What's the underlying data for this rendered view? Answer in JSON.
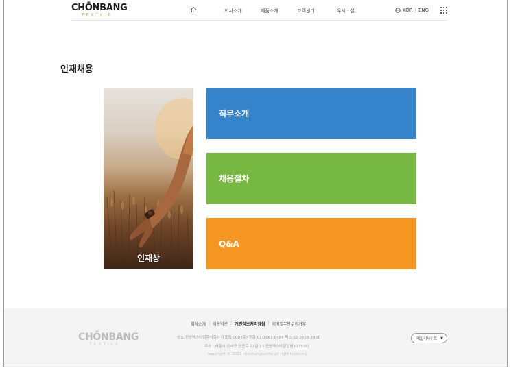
{
  "header": {
    "logo_main": "CHŌNBANG",
    "logo_sub": "TEXTILE",
    "nav": [
      {
        "label": "회사소개"
      },
      {
        "label": "제품소개"
      },
      {
        "label": "고객센터"
      },
      {
        "label": "우시 · 설"
      }
    ],
    "lang_kor": "KOR",
    "lang_sep": "|",
    "lang_eng": "ENG"
  },
  "page": {
    "title": "인재채용"
  },
  "hero": {
    "label": "인재상"
  },
  "menu": [
    {
      "label": "직무소개",
      "color": "#3583cb"
    },
    {
      "label": "채용절차",
      "color": "#77b843"
    },
    {
      "label": "Q&A",
      "color": "#f59522"
    }
  ],
  "footer": {
    "links": [
      {
        "label": "회사소개"
      },
      {
        "label": "이용약관"
      },
      {
        "label": "개인정보처리방침"
      },
      {
        "label": "이메일무단수집거부"
      }
    ],
    "logo_main": "CHŌNBANG",
    "logo_sub": "TEXTILE",
    "info_line1": "상호:전방텍스타일주식회사   대표자:000 (주)   전화:02-3663-8484   팩스:02-3663-8481",
    "info_line2": "주소 : 서울시 강서구 양천로 77길 13 전방텍스타일빌딩 (07538)",
    "info_line3": "copyright © 2023 chonbangtextile all right reserved.",
    "family_site": "패밀리사이트"
  }
}
